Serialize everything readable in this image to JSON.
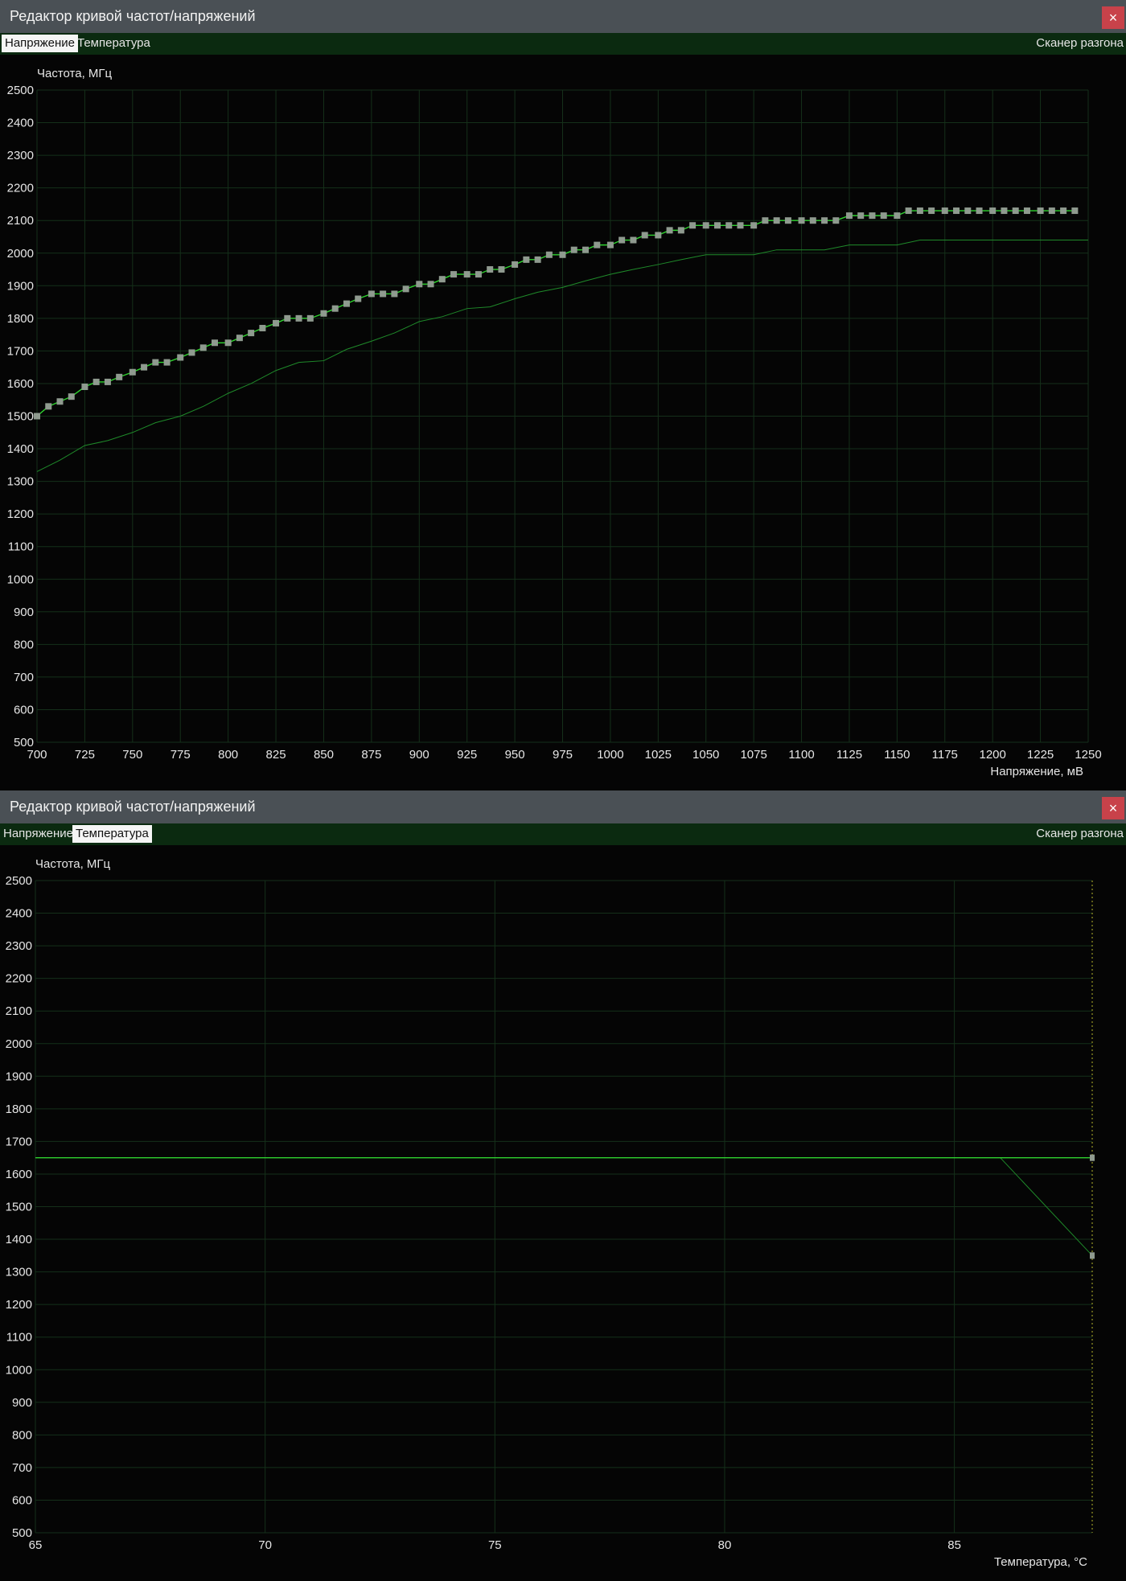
{
  "windows": [
    {
      "title": "Редактор кривой частот/напряжений",
      "close_symbol": "×",
      "tabs": [
        {
          "label": "Напряжение",
          "active": true
        },
        {
          "label": "Температура",
          "active": false
        }
      ],
      "scanner_label": "Сканер разгона"
    },
    {
      "title": "Редактор кривой частот/напряжений",
      "close_symbol": "×",
      "tabs": [
        {
          "label": "Напряжение",
          "active": false
        },
        {
          "label": "Температура",
          "active": true
        }
      ],
      "scanner_label": "Сканер разгона"
    }
  ],
  "colors": {
    "curve": "#2fd42f",
    "base_curve": "#1f8a2a",
    "marker": "#8f9a8f",
    "grid": "#15301a"
  },
  "chart_data": [
    {
      "type": "line",
      "ylabel": "Частота, МГц",
      "xlabel": "Напряжение, мВ",
      "xlim": [
        700,
        1250
      ],
      "ylim": [
        500,
        2500
      ],
      "xticks": [
        700,
        725,
        750,
        775,
        800,
        825,
        850,
        875,
        900,
        925,
        950,
        975,
        1000,
        1025,
        1050,
        1075,
        1100,
        1125,
        1150,
        1175,
        1200,
        1225,
        1250
      ],
      "yticks": [
        500,
        600,
        700,
        800,
        900,
        1000,
        1100,
        1200,
        1300,
        1400,
        1500,
        1600,
        1700,
        1800,
        1900,
        2000,
        2100,
        2200,
        2300,
        2400,
        2500
      ],
      "grid": true,
      "series": [
        {
          "role": "curve",
          "markers": true,
          "x": [
            700,
            706,
            712,
            718,
            725,
            731,
            737,
            743,
            750,
            756,
            762,
            768,
            775,
            781,
            787,
            793,
            800,
            806,
            812,
            818,
            825,
            831,
            837,
            843,
            850,
            856,
            862,
            868,
            875,
            881,
            887,
            893,
            900,
            906,
            912,
            918,
            925,
            931,
            937,
            943,
            950,
            956,
            962,
            968,
            975,
            981,
            987,
            993,
            1000,
            1006,
            1012,
            1018,
            1025,
            1031,
            1037,
            1043,
            1050,
            1056,
            1062,
            1068,
            1075,
            1081,
            1087,
            1093,
            1100,
            1106,
            1112,
            1118,
            1125,
            1131,
            1137,
            1143,
            1150,
            1156,
            1162,
            1168,
            1175,
            1181,
            1187,
            1193,
            1200,
            1206,
            1212,
            1218,
            1225,
            1231,
            1237,
            1243
          ],
          "y": [
            1500,
            1530,
            1545,
            1560,
            1590,
            1605,
            1605,
            1620,
            1635,
            1650,
            1665,
            1665,
            1680,
            1695,
            1710,
            1725,
            1725,
            1740,
            1755,
            1770,
            1785,
            1800,
            1800,
            1800,
            1815,
            1830,
            1845,
            1860,
            1875,
            1875,
            1875,
            1890,
            1905,
            1905,
            1920,
            1935,
            1935,
            1935,
            1950,
            1950,
            1965,
            1980,
            1980,
            1995,
            1995,
            2010,
            2010,
            2025,
            2025,
            2040,
            2040,
            2055,
            2055,
            2070,
            2070,
            2085,
            2085,
            2085,
            2085,
            2085,
            2085,
            2100,
            2100,
            2100,
            2100,
            2100,
            2100,
            2100,
            2115,
            2115,
            2115,
            2115,
            2115,
            2130,
            2130,
            2130,
            2130,
            2130,
            2130,
            2130,
            2130,
            2130,
            2130,
            2130,
            2130,
            2130,
            2130,
            2130
          ]
        },
        {
          "role": "base",
          "markers": false,
          "x": [
            700,
            712,
            725,
            737,
            750,
            762,
            775,
            787,
            800,
            812,
            825,
            837,
            850,
            862,
            875,
            887,
            900,
            912,
            925,
            937,
            950,
            962,
            975,
            987,
            1000,
            1012,
            1025,
            1037,
            1050,
            1062,
            1075,
            1087,
            1100,
            1112,
            1125,
            1137,
            1150,
            1162,
            1175,
            1187,
            1200,
            1212,
            1225,
            1237,
            1250
          ],
          "y": [
            1330,
            1365,
            1410,
            1425,
            1450,
            1480,
            1500,
            1530,
            1570,
            1600,
            1640,
            1665,
            1670,
            1705,
            1730,
            1755,
            1790,
            1805,
            1830,
            1835,
            1860,
            1880,
            1895,
            1915,
            1935,
            1950,
            1965,
            1980,
            1995,
            1995,
            1995,
            2010,
            2010,
            2010,
            2025,
            2025,
            2025,
            2040,
            2040,
            2040,
            2040,
            2040,
            2040,
            2040,
            2040
          ]
        }
      ]
    },
    {
      "type": "line",
      "ylabel": "Частота, МГц",
      "xlabel": "Температура, °С",
      "xlim": [
        65,
        88
      ],
      "ylim": [
        500,
        2500
      ],
      "xticks": [
        65,
        70,
        75,
        80,
        85
      ],
      "yticks": [
        500,
        600,
        700,
        800,
        900,
        1000,
        1100,
        1200,
        1300,
        1400,
        1500,
        1600,
        1700,
        1800,
        1900,
        2000,
        2100,
        2200,
        2300,
        2400,
        2500
      ],
      "grid": true,
      "series": [
        {
          "role": "curve",
          "markers": false,
          "x": [
            65,
            88
          ],
          "y": [
            1650,
            1650
          ]
        },
        {
          "role": "base",
          "markers": false,
          "x": [
            86,
            88
          ],
          "y": [
            1650,
            1350
          ]
        }
      ],
      "point_markers": [
        {
          "x": 88,
          "y": 1650
        },
        {
          "x": 88,
          "y": 1350
        }
      ],
      "marker_line_x": 88
    }
  ]
}
